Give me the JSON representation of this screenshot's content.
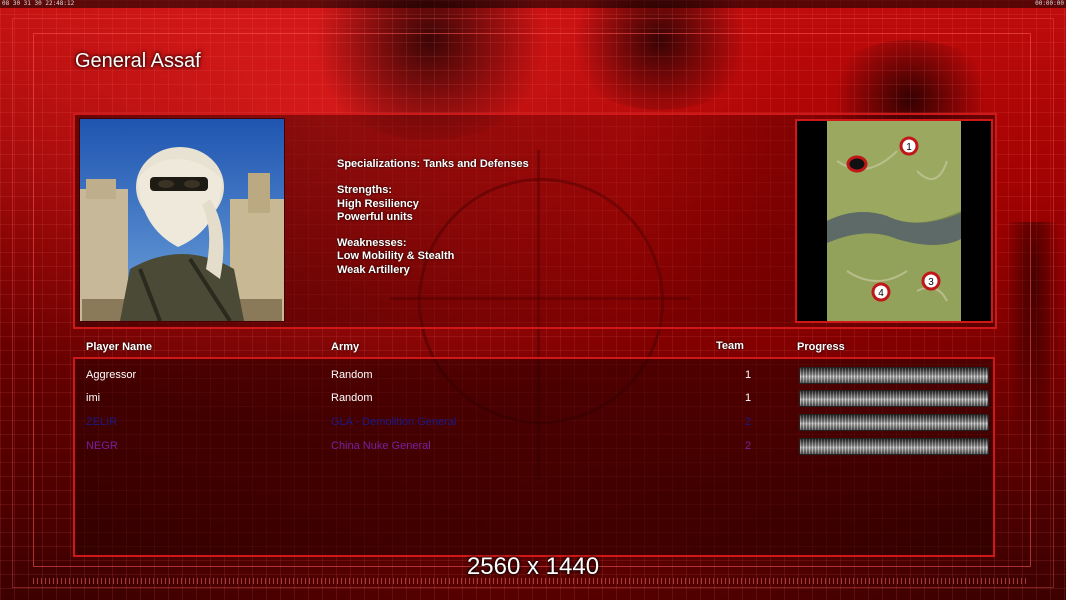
{
  "hud": {
    "left_readout": "08 30 31 30 22:48:12",
    "right_readout": "00:00:00"
  },
  "general": {
    "name": "General Assaf",
    "specializations": "Specializations: Tanks and Defenses",
    "strengths_heading": "Strengths:",
    "strengths": [
      "High Resiliency",
      "Powerful units"
    ],
    "weaknesses_heading": "Weaknesses:",
    "weaknesses": [
      "Low Mobility & Stealth",
      "Weak Artillery"
    ]
  },
  "map": {
    "markers": [
      "1",
      "",
      "3",
      "4"
    ]
  },
  "table": {
    "headers": {
      "player_name": "Player Name",
      "army": "Army",
      "team": "Team",
      "progress": "Progress"
    },
    "rows": [
      {
        "player": "Aggressor",
        "army": "Random",
        "team": "1",
        "color": "#ffffff",
        "progress": 1.0
      },
      {
        "player": "imi",
        "army": "Random",
        "team": "1",
        "color": "#ffffff",
        "progress": 1.0
      },
      {
        "player": "ZELIR",
        "army": "GLA - Demolition General",
        "team": "2",
        "color": "#1a1a8a",
        "progress": 1.0
      },
      {
        "player": "NEGR",
        "army": "China Nuke General",
        "team": "2",
        "color": "#7a1fa0",
        "progress": 1.0
      }
    ]
  },
  "footer": {
    "resolution": "2560 x 1440"
  },
  "colors": {
    "accent": "#d01818",
    "background": "#7a0000"
  }
}
